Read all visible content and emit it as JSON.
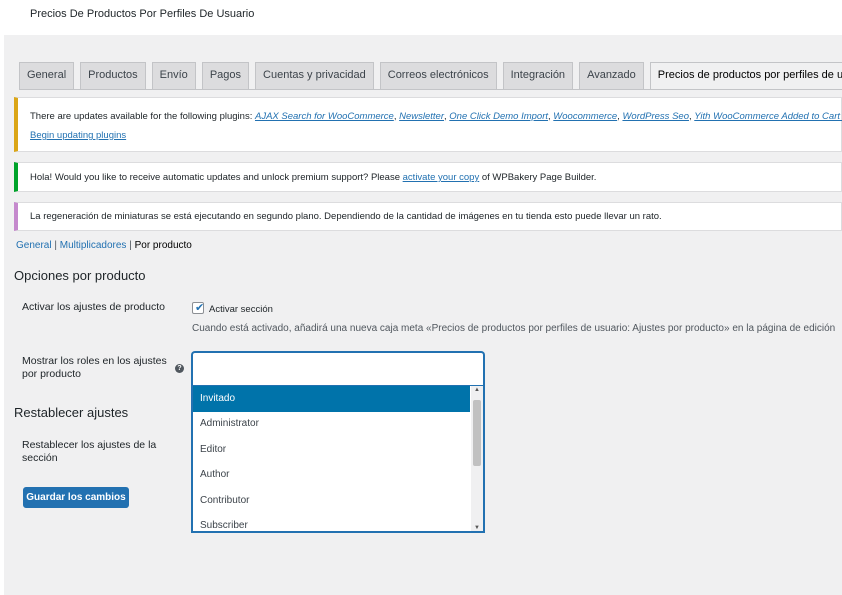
{
  "page": {
    "title": "Precios De Productos Por Perfiles De Usuario"
  },
  "tabs": [
    {
      "label": "General"
    },
    {
      "label": "Productos"
    },
    {
      "label": "Envío"
    },
    {
      "label": "Pagos"
    },
    {
      "label": "Cuentas y privacidad"
    },
    {
      "label": "Correos electrónicos"
    },
    {
      "label": "Integración"
    },
    {
      "label": "Avanzado"
    },
    {
      "label": "Precios de productos por perfiles de usuario",
      "active": true
    }
  ],
  "notices": {
    "updates": {
      "prefix": "There are updates available for the following plugins: ",
      "plugins": [
        "AJAX Search for WooCommerce",
        "Newsletter",
        "One Click Demo Import",
        "Woocommerce",
        "WordPress Seo",
        "Yith WooCommerce Added to Cart P"
      ],
      "separator": ", ",
      "action_link": "Begin updating plugins"
    },
    "wpbakery": {
      "text_before": "Hola! Would you like to receive automatic updates and unlock premium support? Please ",
      "link": "activate your copy",
      "text_after": " of WPBakery Page Builder."
    },
    "regeneration": {
      "text": "La regeneración de miniaturas se está ejecutando en segundo plano. Dependiendo de la cantidad de imágenes en tu tienda esto puede llevar un rato."
    }
  },
  "subnav": {
    "general": "General",
    "sep1": " | ",
    "multiplicadores": "Multiplicadores",
    "sep2": " | ",
    "current": "Por producto"
  },
  "section_options": {
    "title": "Opciones por producto",
    "activar_label": "Activar los ajustes de producto",
    "checkbox_checked": true,
    "checkbox_label": "Activar sección",
    "description": "Cuando está activado, añadirá una nueva caja meta «Precios de productos por perfiles de usuario: Ajustes por producto» en la página de edición",
    "mostrar_label": "Mostrar los roles en los ajustes por producto",
    "help_icon": "question-icon",
    "roles_options": [
      "Invitado",
      "Administrator",
      "Editor",
      "Author",
      "Contributor",
      "Subscriber"
    ],
    "highlighted_option": "Invitado"
  },
  "section_reset": {
    "title": "Restablecer ajustes",
    "reset_label": "Restablecer los ajustes de la sección"
  },
  "save_button": "Guardar los cambios",
  "colors": {
    "accent": "#2271b1",
    "highlight": "#0073aa",
    "warning_border": "#dba617",
    "success_border": "#00a32a",
    "info_border": "#c589cd"
  }
}
